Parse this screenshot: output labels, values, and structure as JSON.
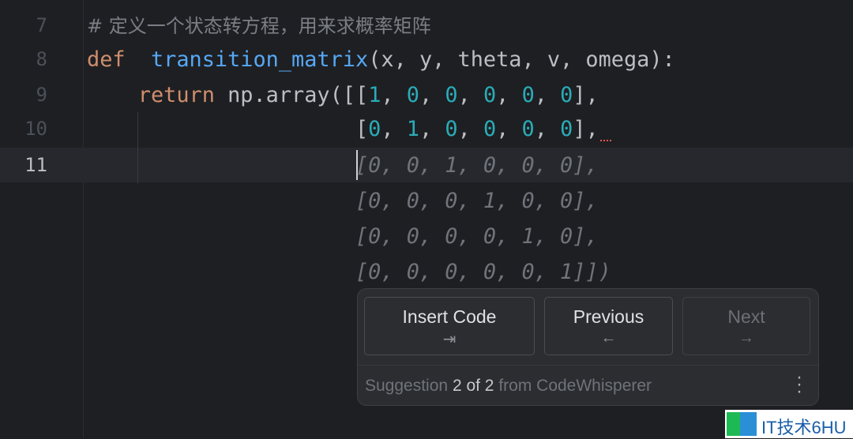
{
  "editor": {
    "line_numbers": [
      "7",
      "8",
      "9",
      "10",
      "11"
    ],
    "current_line": "11",
    "lines": {
      "l7": {
        "comment": "# 定义一个状态转方程，用来求概率矩阵"
      },
      "l8": {
        "kw": "def",
        "fn": "transition_matrix",
        "params": "(x, y, theta, v, omega):"
      },
      "l9": {
        "kw": "return",
        "rest": " np.array([[",
        "nums": [
          "1",
          "0",
          "0",
          "0",
          "0",
          "0"
        ],
        "end": "],"
      },
      "l10": {
        "nums": [
          "0",
          "1",
          "0",
          "0",
          "0",
          "0"
        ],
        "end": "],"
      }
    },
    "ghost_lines": [
      "[0, 0, 1, 0, 0, 0],",
      "[0, 0, 0, 1, 0, 0],",
      "[0, 0, 0, 0, 1, 0],",
      "[0, 0, 0, 0, 0, 1]])"
    ]
  },
  "suggestion_popup": {
    "buttons": [
      {
        "label": "Insert Code",
        "icon": "tab-arrow-icon",
        "glyph": "⇥",
        "enabled": true
      },
      {
        "label": "Previous",
        "icon": "arrow-left-icon",
        "glyph": "←",
        "enabled": true
      },
      {
        "label": "Next",
        "icon": "arrow-right-icon",
        "glyph": "→",
        "enabled": false
      }
    ],
    "footer": {
      "prefix": "Suggestion",
      "count": "2 of 2",
      "suffix": "from CodeWhisperer"
    }
  },
  "watermark": {
    "text": "IT技术6HU"
  },
  "colors": {
    "background": "#1e1f22",
    "keyword": "#cf8e6d",
    "function": "#56a8f5",
    "number": "#2aacb8"
  }
}
